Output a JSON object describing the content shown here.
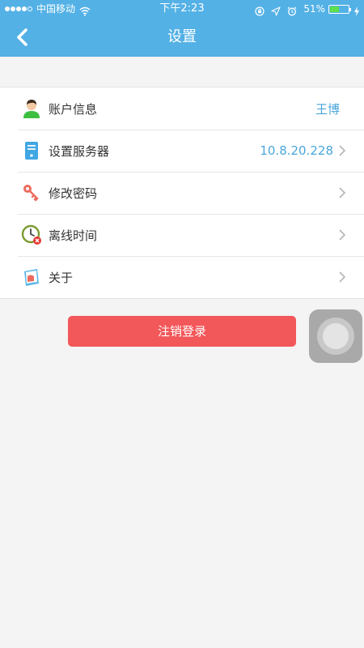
{
  "status_bar": {
    "carrier": "中国移动",
    "time": "下午2:23",
    "battery_percent": "51%",
    "battery_level": 0.51,
    "signal_bars_filled": 4,
    "signal_bars_total": 5,
    "icons": [
      "wifi-icon",
      "orientation-lock-icon",
      "location-icon",
      "alarm-icon",
      "battery-icon",
      "charging-icon"
    ]
  },
  "nav": {
    "title": "设置",
    "back_icon": "chevron-left-icon"
  },
  "menu": [
    {
      "id": "account",
      "label": "账户信息",
      "value": "王博",
      "icon": "user-icon",
      "has_chevron": false
    },
    {
      "id": "server",
      "label": "设置服务器",
      "value": "10.8.20.228",
      "icon": "server-icon",
      "has_chevron": true
    },
    {
      "id": "password",
      "label": "修改密码",
      "value": "",
      "icon": "key-icon",
      "has_chevron": true
    },
    {
      "id": "offline",
      "label": "离线时间",
      "value": "",
      "icon": "clock-icon",
      "has_chevron": true
    },
    {
      "id": "about",
      "label": "关于",
      "value": "",
      "icon": "info-book-icon",
      "has_chevron": true
    }
  ],
  "logout": {
    "label": "注销登录"
  },
  "colors": {
    "header": "#53b1e6",
    "accent_value": "#4aa6db",
    "logout": "#f25759",
    "background": "#f4f4f4"
  }
}
